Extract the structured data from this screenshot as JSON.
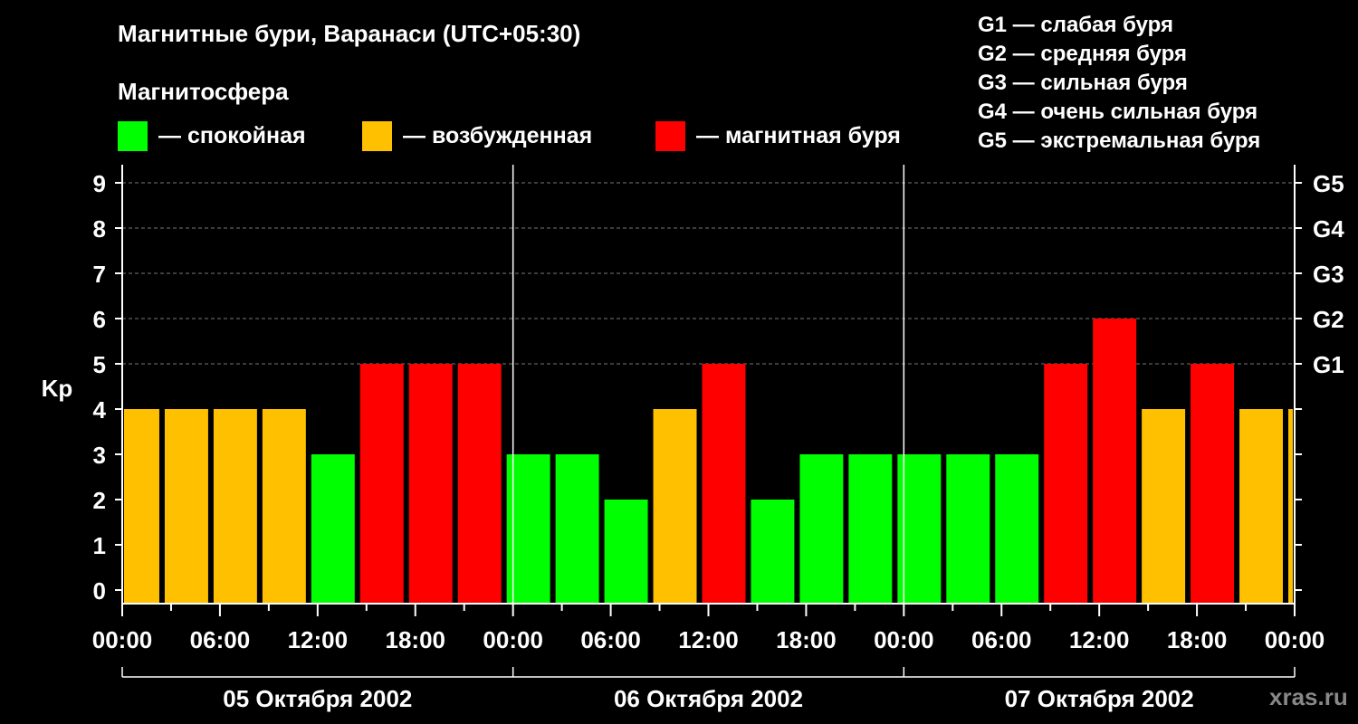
{
  "title": "Магнитные бури, Варанаси (UTC+05:30)",
  "subtitle": "Магнитосфера",
  "legend": [
    {
      "label": "— спокойная",
      "color": "#00ff00"
    },
    {
      "label": "— возбужденная",
      "color": "#ffc000"
    },
    {
      "label": "— магнитная буря",
      "color": "#ff0000"
    }
  ],
  "g_legend": [
    "G1 — слабая буря",
    "G2 — средняя буря",
    "G3 — сильная буря",
    "G4 — очень сильная буря",
    "G5 — экстремальная буря"
  ],
  "watermark": "xras.ru",
  "chart_data": {
    "type": "bar",
    "ylabel": "Kp",
    "ylim": [
      0,
      9
    ],
    "y_ticks": [
      "0",
      "1",
      "2",
      "3",
      "4",
      "5",
      "6",
      "7",
      "8",
      "9"
    ],
    "right_ticks": [
      {
        "value": 5,
        "label": "G1"
      },
      {
        "value": 6,
        "label": "G2"
      },
      {
        "value": 7,
        "label": "G3"
      },
      {
        "value": 8,
        "label": "G4"
      },
      {
        "value": 9,
        "label": "G5"
      }
    ],
    "x_tick_labels": [
      "00:00",
      "06:00",
      "12:00",
      "18:00",
      "00:00",
      "06:00",
      "12:00",
      "18:00",
      "00:00",
      "06:00",
      "12:00",
      "18:00",
      "00:00"
    ],
    "days": [
      "05 Октября 2002",
      "06 Октября 2002",
      "07 Октября 2002"
    ],
    "interval_hours": 3,
    "start_offset_hours": 0.5,
    "values": [
      4,
      4,
      4,
      4,
      3,
      5,
      5,
      5,
      3,
      3,
      2,
      4,
      5,
      2,
      3,
      3,
      3,
      3,
      3,
      5,
      6,
      4,
      5,
      4,
      4
    ],
    "thresholds": {
      "quiet_max": 3,
      "active": 4,
      "storm_min": 5
    },
    "grid": true
  }
}
